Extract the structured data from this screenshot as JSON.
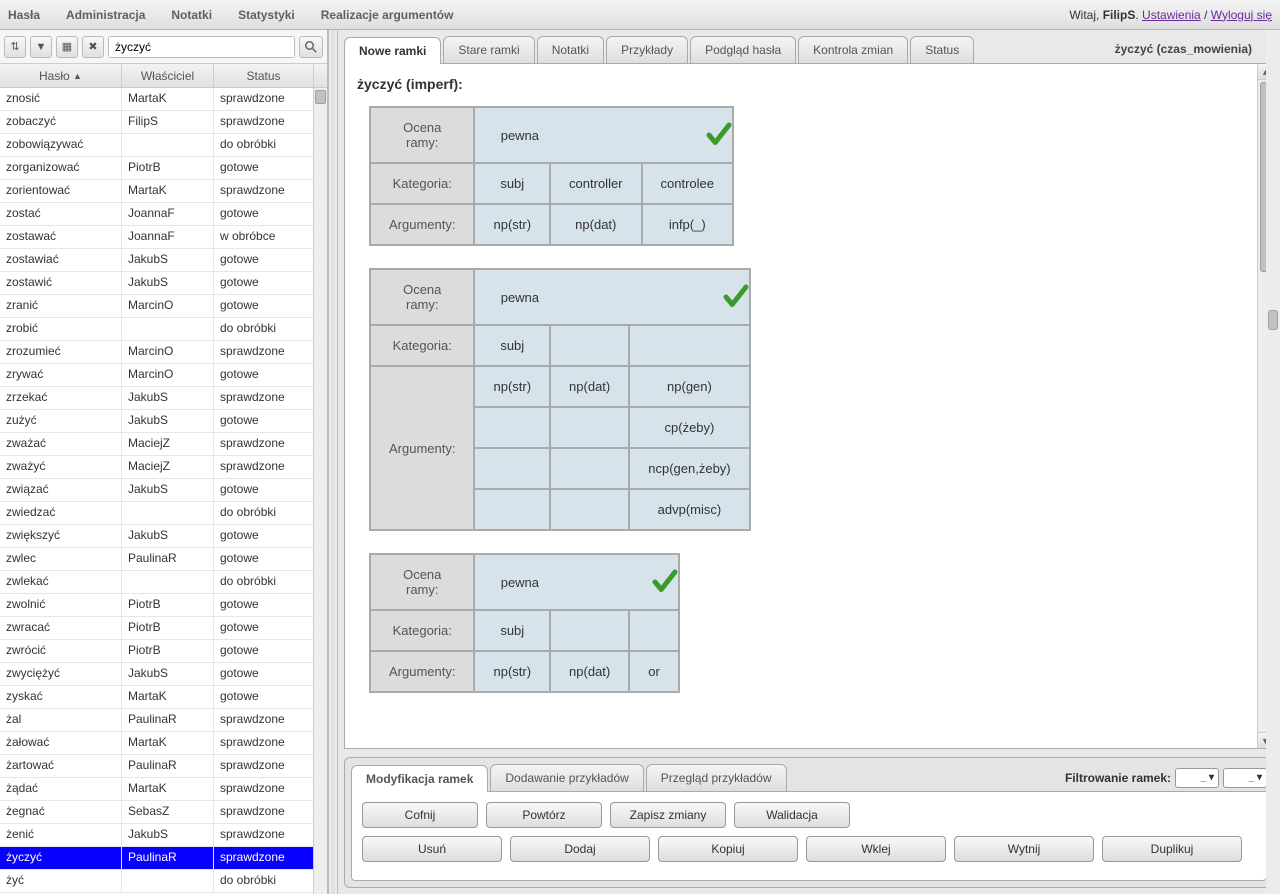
{
  "top": {
    "nav": [
      "Hasła",
      "Administracja",
      "Notatki",
      "Statystyki",
      "Realizacje argumentów"
    ],
    "welcome_prefix": "Witaj, ",
    "user": "FilipS",
    "settings": "Ustawienia",
    "sep": " / ",
    "logout": "Wyloguj się",
    "dot": ". "
  },
  "left": {
    "search_value": "życzyć",
    "columns": {
      "c1": "Hasło",
      "c1_sort": "▲",
      "c2": "Właściciel",
      "c3": "Status"
    },
    "rows": [
      {
        "h": "znosić",
        "w": "MartaK",
        "s": "sprawdzone"
      },
      {
        "h": "zobaczyć",
        "w": "FilipS",
        "s": "sprawdzone"
      },
      {
        "h": "zobowiązywać",
        "w": "",
        "s": "do obróbki"
      },
      {
        "h": "zorganizować",
        "w": "PiotrB",
        "s": "gotowe"
      },
      {
        "h": "zorientować",
        "w": "MartaK",
        "s": "sprawdzone"
      },
      {
        "h": "zostać",
        "w": "JoannaF",
        "s": "gotowe"
      },
      {
        "h": "zostawać",
        "w": "JoannaF",
        "s": "w obróbce"
      },
      {
        "h": "zostawiać",
        "w": "JakubS",
        "s": "gotowe"
      },
      {
        "h": "zostawić",
        "w": "JakubS",
        "s": "gotowe"
      },
      {
        "h": "zranić",
        "w": "MarcinO",
        "s": "gotowe"
      },
      {
        "h": "zrobić",
        "w": "",
        "s": "do obróbki"
      },
      {
        "h": "zrozumieć",
        "w": "MarcinO",
        "s": "sprawdzone"
      },
      {
        "h": "zrywać",
        "w": "MarcinO",
        "s": "gotowe"
      },
      {
        "h": "zrzekać",
        "w": "JakubS",
        "s": "sprawdzone"
      },
      {
        "h": "zużyć",
        "w": "JakubS",
        "s": "gotowe"
      },
      {
        "h": "zważać",
        "w": "MaciejZ",
        "s": "sprawdzone"
      },
      {
        "h": "zważyć",
        "w": "MaciejZ",
        "s": "sprawdzone"
      },
      {
        "h": "związać",
        "w": "JakubS",
        "s": "gotowe"
      },
      {
        "h": "zwiedzać",
        "w": "",
        "s": "do obróbki"
      },
      {
        "h": "zwiększyć",
        "w": "JakubS",
        "s": "gotowe"
      },
      {
        "h": "zwlec",
        "w": "PaulinaR",
        "s": "gotowe"
      },
      {
        "h": "zwlekać",
        "w": "",
        "s": "do obróbki"
      },
      {
        "h": "zwolnić",
        "w": "PiotrB",
        "s": "gotowe"
      },
      {
        "h": "zwracać",
        "w": "PiotrB",
        "s": "gotowe"
      },
      {
        "h": "zwrócić",
        "w": "PiotrB",
        "s": "gotowe"
      },
      {
        "h": "zwyciężyć",
        "w": "JakubS",
        "s": "gotowe"
      },
      {
        "h": "zyskać",
        "w": "MartaK",
        "s": "gotowe"
      },
      {
        "h": "żal",
        "w": "PaulinaR",
        "s": "sprawdzone"
      },
      {
        "h": "żałować",
        "w": "MartaK",
        "s": "sprawdzone"
      },
      {
        "h": "żartować",
        "w": "PaulinaR",
        "s": "sprawdzone"
      },
      {
        "h": "żądać",
        "w": "MartaK",
        "s": "sprawdzone"
      },
      {
        "h": "żegnać",
        "w": "SebasZ",
        "s": "sprawdzone"
      },
      {
        "h": "żenić",
        "w": "JakubS",
        "s": "sprawdzone"
      },
      {
        "h": "życzyć",
        "w": "PaulinaR",
        "s": "sprawdzone",
        "sel": true
      },
      {
        "h": "żyć",
        "w": "",
        "s": "do obróbki"
      }
    ]
  },
  "ctx_right": "życzyć (czas_mowienia)",
  "main": {
    "tabs": [
      "Nowe ramki",
      "Stare ramki",
      "Notatki",
      "Przykłady",
      "Podgląd hasła",
      "Kontrola zmian",
      "Status"
    ],
    "active": 0,
    "title": "życzyć (imperf):",
    "labels": {
      "ocena": "Ocena ramy:",
      "kategoria": "Kategoria:",
      "argumenty": "Argumenty:"
    },
    "frames": [
      {
        "ocena": "pewna",
        "check": true,
        "kat_cells": [
          "subj",
          "controller",
          "controlee"
        ],
        "arg_rows": [
          [
            "np(str)",
            "np(dat)",
            "infp(_)"
          ]
        ]
      },
      {
        "ocena": "pewna",
        "check": true,
        "kat_cells": [
          "subj",
          "",
          ""
        ],
        "arg_rows": [
          [
            "np(str)",
            "np(dat)",
            "np(gen)"
          ],
          [
            "",
            "",
            "cp(żeby)"
          ],
          [
            "",
            "",
            "ncp(gen,żeby)"
          ],
          [
            "",
            "",
            "advp(misc)"
          ]
        ]
      },
      {
        "ocena": "pewna",
        "check": true,
        "kat_cells": [
          "subj",
          "",
          ""
        ],
        "arg_rows": [
          [
            "np(str)",
            "np(dat)",
            "or"
          ]
        ]
      }
    ]
  },
  "bottom": {
    "tabs": [
      "Modyfikacja ramek",
      "Dodawanie przykładów",
      "Przegląd przykładów"
    ],
    "active": 0,
    "filter_label": "Filtrowanie ramek:",
    "filter_v1": "_",
    "filter_v2": "_",
    "row1": [
      "Cofnij",
      "Powtórz",
      "Zapisz zmiany",
      "Walidacja"
    ],
    "row2": [
      "Usuń",
      "Dodaj",
      "Kopiuj",
      "Wklej",
      "Wytnij",
      "Duplikuj"
    ]
  }
}
